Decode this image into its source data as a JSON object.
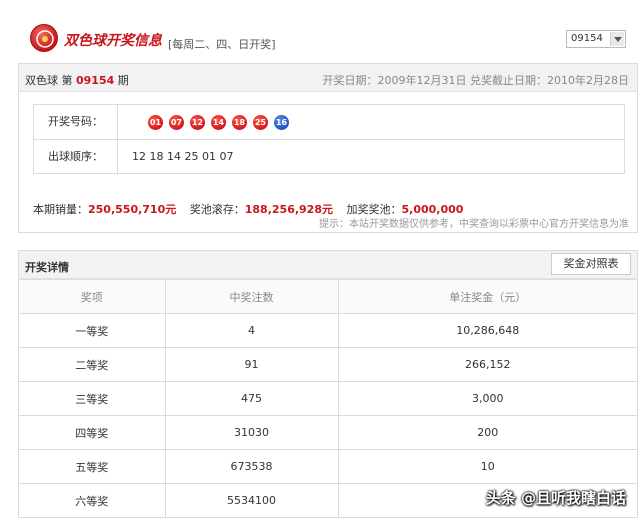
{
  "header": {
    "title": "双色球开奖信息",
    "schedule": "[每周二、四、日开奖]",
    "issue_select": "09154"
  },
  "draw": {
    "game_name": "双色球 第",
    "issue": "09154",
    "issue_suffix": "期",
    "dates": "开奖日期：2009年12月31日 兑奖截止日期：2010年2月28日",
    "numbers_label": "开奖号码：",
    "red_balls": [
      "01",
      "07",
      "12",
      "14",
      "18",
      "25"
    ],
    "blue_ball": "16",
    "order_label": "出球顺序：",
    "order": "12 18 14 25 01 07",
    "sales_label": "本期销量：",
    "sales_value": "250,550,710元",
    "pool_label": "奖池滚存：",
    "pool_value": "188,256,928元",
    "bonus_label": "加奖奖池：",
    "bonus_value": "5,000,000",
    "tip": "提示：本站开奖数据仅供参考，中奖查询以彩票中心官方开奖信息为准"
  },
  "details": {
    "title": "开奖详情",
    "compare_button": "奖金对照表",
    "columns": [
      "奖项",
      "中奖注数",
      "单注奖金（元）"
    ],
    "rows": [
      [
        "一等奖",
        "4",
        "10,286,648"
      ],
      [
        "二等奖",
        "91",
        "266,152"
      ],
      [
        "三等奖",
        "475",
        "3,000"
      ],
      [
        "四等奖",
        "31030",
        "200"
      ],
      [
        "五等奖",
        "673538",
        "10"
      ],
      [
        "六等奖",
        "5534100",
        ""
      ]
    ]
  },
  "watermark": "头条 @且听我瞎白话",
  "colors": {
    "accent": "#c8161d",
    "blue_ball": "#1d4fb8"
  }
}
